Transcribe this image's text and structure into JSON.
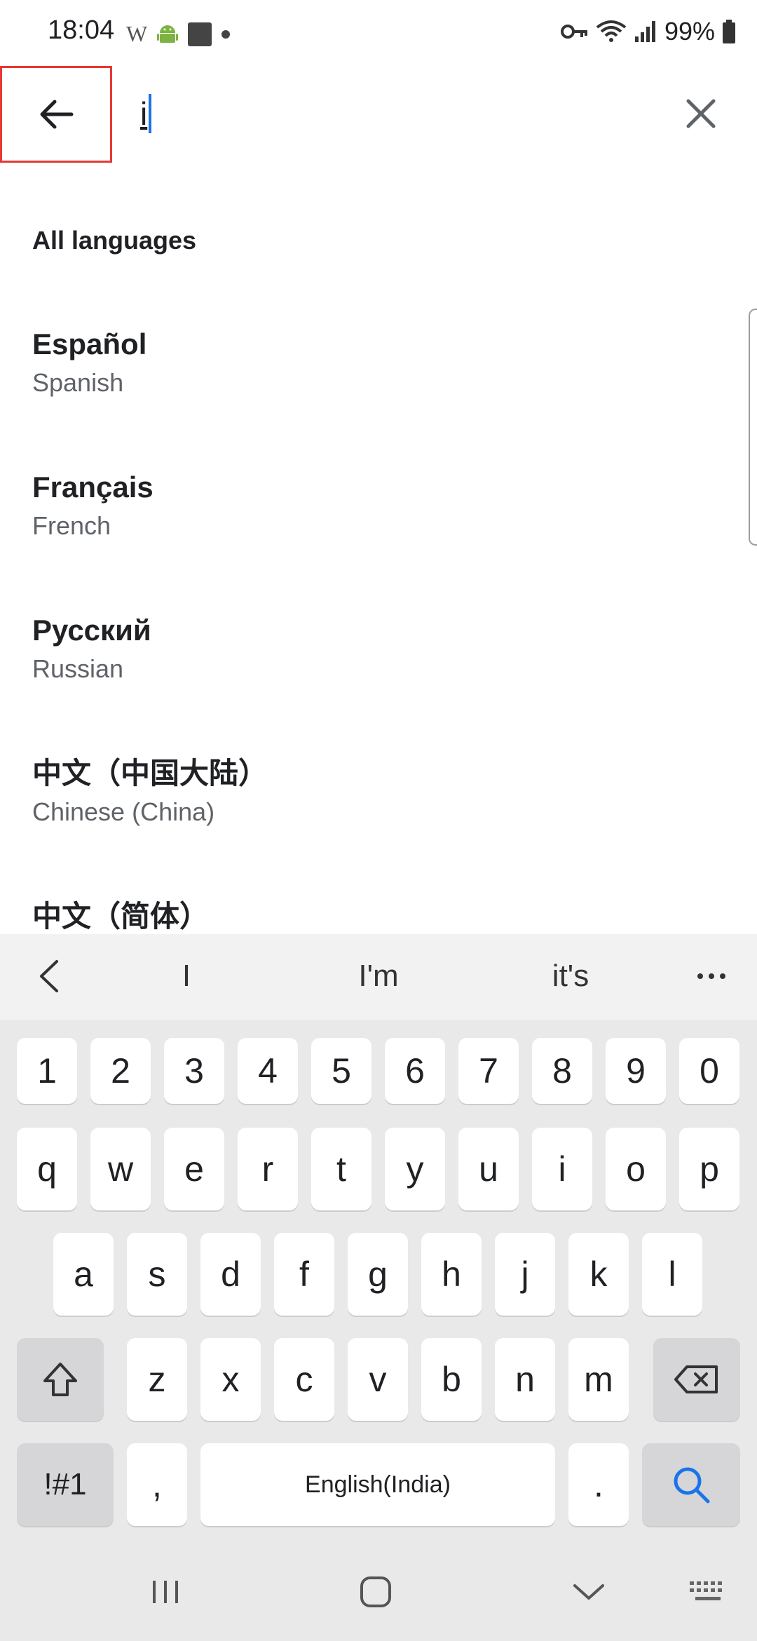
{
  "status_bar": {
    "time": "18:04",
    "w_glyph": "W",
    "battery_percent": "99%",
    "icons": [
      "w-app-icon",
      "android-icon",
      "square-icon",
      "dot-icon",
      "vpn-key-icon",
      "wifi-icon",
      "signal-icon",
      "battery-icon"
    ]
  },
  "search": {
    "value": "i",
    "back_icon": "arrow-back-icon",
    "clear_icon": "close-icon"
  },
  "section": {
    "title": "All languages"
  },
  "languages": [
    {
      "name": "Español",
      "english": "Spanish"
    },
    {
      "name": "Français",
      "english": "French"
    },
    {
      "name": "Русский",
      "english": "Russian"
    },
    {
      "name": "中文（中国大陆）",
      "english": "Chinese (China)"
    },
    {
      "name": "中文（简体）",
      "english": ""
    }
  ],
  "keyboard": {
    "suggestions": [
      "I",
      "I'm",
      "it's"
    ],
    "row_numbers": [
      "1",
      "2",
      "3",
      "4",
      "5",
      "6",
      "7",
      "8",
      "9",
      "0"
    ],
    "row_q": [
      "q",
      "w",
      "e",
      "r",
      "t",
      "y",
      "u",
      "i",
      "o",
      "p"
    ],
    "row_a": [
      "a",
      "s",
      "d",
      "f",
      "g",
      "h",
      "j",
      "k",
      "l"
    ],
    "row_z": [
      "z",
      "x",
      "c",
      "v",
      "b",
      "n",
      "m"
    ],
    "symbols_label": "!#1",
    "comma_label": ",",
    "space_label": "English(India)",
    "period_label": ".",
    "accent_color": "#1a73e8"
  },
  "nav_bar": {
    "icons": [
      "recents-icon",
      "home-icon",
      "hide-keyboard-icon",
      "keyboard-icon"
    ]
  }
}
